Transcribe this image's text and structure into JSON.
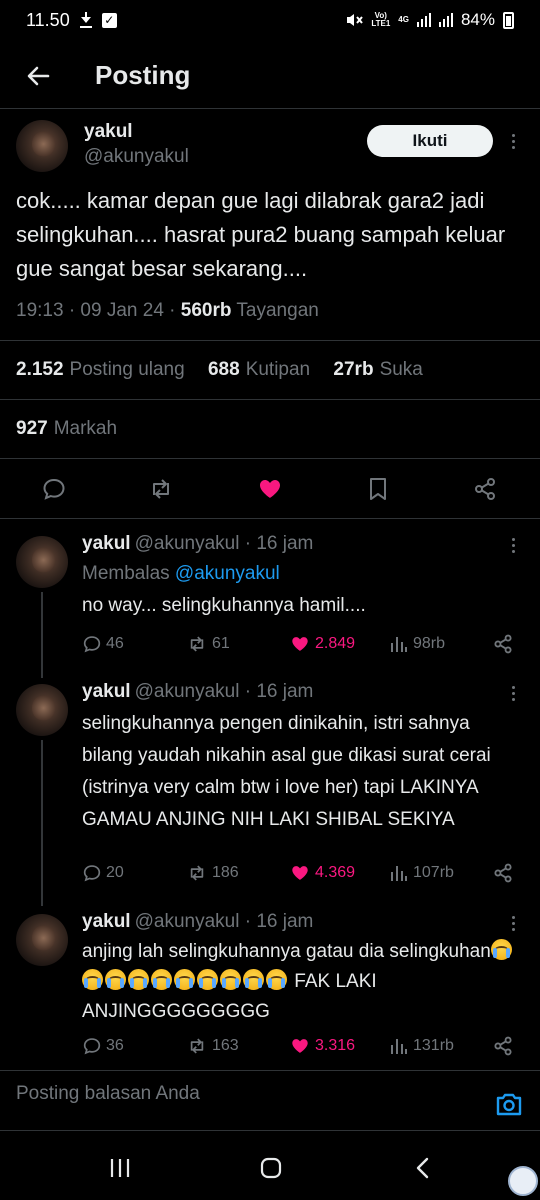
{
  "status_bar": {
    "time": "11.50",
    "battery": "84%",
    "network_small": "Vo) 4G LTE1",
    "network_label": "4G"
  },
  "header": {
    "title": "Posting"
  },
  "main_tweet": {
    "name": "yakul",
    "handle": "@akunyakul",
    "follow_label": "Ikuti",
    "text": "cok..... kamar depan gue lagi dilabrak gara2 jadi selingkuhan.... hasrat pura2 buang sampah keluar gue sangat besar sekarang....",
    "time": "19:13 · 09 Jan 24 · ",
    "views": "560rb",
    "views_label": " Tayangan",
    "reposts": "2.152",
    "reposts_label": "Posting ulang",
    "quotes": "688",
    "quotes_label": "Kutipan",
    "likes": "27rb",
    "likes_label": "Suka",
    "bookmarks": "927",
    "bookmarks_label": "Markah"
  },
  "replies": [
    {
      "name": "yakul",
      "handle": "@akunyakul",
      "time": " · 16 jam",
      "replying_prefix": "Membalas ",
      "replying_to": "@akunyakul",
      "text": "no way... selingkuhannya hamil....",
      "replies": "46",
      "reposts": "61",
      "likes": "2.849",
      "views": "98rb"
    },
    {
      "name": "yakul",
      "handle": "@akunyakul",
      "time": " · 16 jam",
      "text": "selingkuhannya pengen dinikahin, istri sahnya bilang yaudah nikahin asal gue dikasi surat cerai (istrinya very calm btw i love her) tapi LAKINYA GAMAU ANJING NIH LAKI SHIBAL SEKIYA",
      "replies": "20",
      "reposts": "186",
      "likes": "4.369",
      "views": "107rb"
    },
    {
      "name": "yakul",
      "handle": "@akunyakul",
      "time": " · 16 jam",
      "text_before": "anjing lah selingkuhannya gatau dia selingkuhan",
      "emoji_name": "loudly-crying-face",
      "emoji_count": 10,
      "text_after": " FAK LAKI ANJINGGGGGGGGG",
      "replies": "36",
      "reposts": "163",
      "likes": "3.316",
      "views": "131rb"
    }
  ],
  "reply_box": {
    "placeholder": "Posting balasan Anda"
  },
  "colors": {
    "background": "#000000",
    "text": "#e7e9ea",
    "muted": "#71767b",
    "like": "#f91880",
    "link": "#1d9bf0",
    "divider": "#2f3336"
  }
}
